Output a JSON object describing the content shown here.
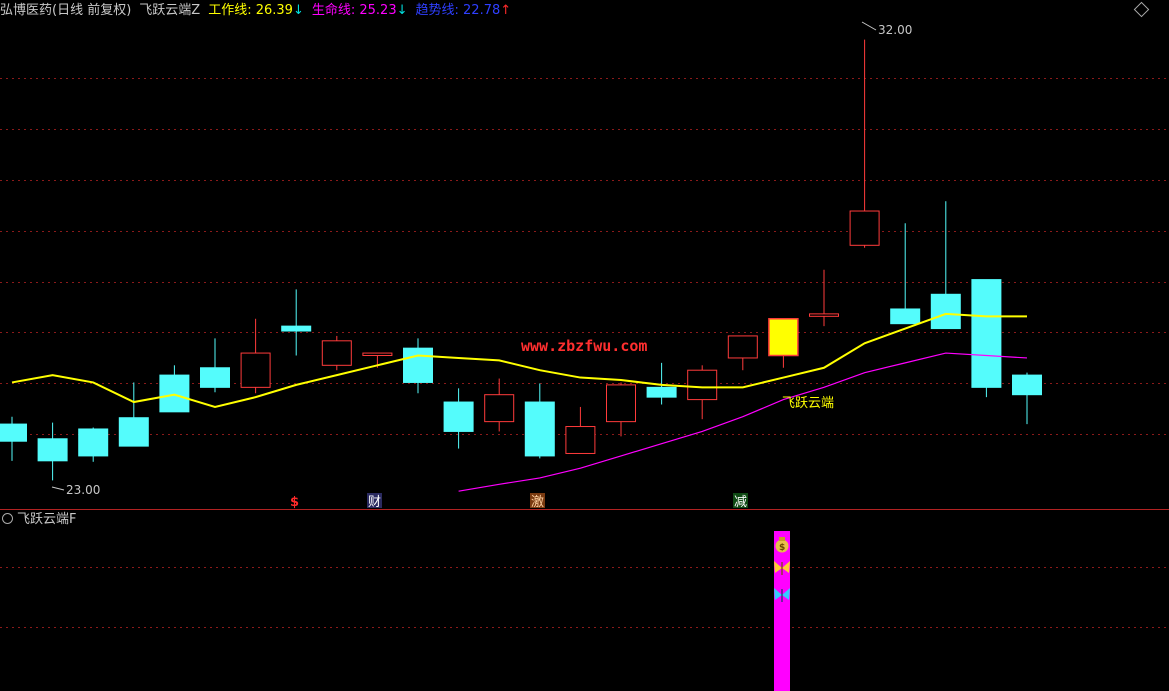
{
  "header": {
    "stock": "弘博医药(日线 前复权)",
    "indicator": "飞跃云端Z",
    "work_line_label": "工作线:",
    "work_line_value": "26.39",
    "work_line_arrow": "↓",
    "life_line_label": "生命线:",
    "life_line_value": "25.23",
    "life_line_arrow": "↓",
    "trend_line_label": "趋势线:",
    "trend_line_value": "22.78",
    "trend_line_arrow": "↑"
  },
  "sub_panel": {
    "title": "飞跃云端F"
  },
  "colors": {
    "background": "#000000",
    "up": "#ff3b3b",
    "down": "#54fcfc",
    "limit_up": "#ffff00",
    "work_line": "#ffff00",
    "life_line": "#ff00ff",
    "trend_line": "#2f3fff",
    "grid": "#8b1a1a",
    "signal_bar": "#ff00ff"
  },
  "annotations": {
    "max_price": "32.00",
    "min_price": "23.00",
    "watermark": "www.zbzfwu.com",
    "line_label": "飞跃云端",
    "signal_dollar": "$",
    "signal_cai": "财",
    "signal_ji": "激",
    "signal_jian": "减"
  },
  "icons": [
    "collapse-icon",
    "circle-icon",
    "money-bag-icon",
    "butterfly-gold-icon",
    "butterfly-cyan-icon"
  ],
  "chart_data": {
    "type": "candlestick",
    "y_range": [
      22.6,
      32.4
    ],
    "candles": [
      {
        "open": 24.15,
        "close": 23.8,
        "high": 24.3,
        "low": 23.4
      },
      {
        "open": 23.85,
        "close": 23.4,
        "high": 24.18,
        "low": 23.0
      },
      {
        "open": 24.05,
        "close": 23.5,
        "high": 24.08,
        "low": 23.38
      },
      {
        "open": 24.28,
        "close": 23.7,
        "high": 25.0,
        "low": 23.7
      },
      {
        "open": 25.15,
        "close": 24.4,
        "high": 25.35,
        "low": 24.4
      },
      {
        "open": 25.3,
        "close": 24.9,
        "high": 25.9,
        "low": 24.8
      },
      {
        "open": 24.9,
        "close": 25.6,
        "high": 26.3,
        "low": 24.78
      },
      {
        "open": 26.15,
        "close": 26.05,
        "high": 26.9,
        "low": 25.55
      },
      {
        "open": 25.35,
        "close": 25.85,
        "high": 25.95,
        "low": 25.25
      },
      {
        "open": 25.55,
        "close": 25.6,
        "high": 25.6,
        "low": 25.3
      },
      {
        "open": 25.7,
        "close": 25.0,
        "high": 25.9,
        "low": 24.78
      },
      {
        "open": 24.6,
        "close": 24.0,
        "high": 24.88,
        "low": 23.65
      },
      {
        "open": 24.2,
        "close": 24.75,
        "high": 25.08,
        "low": 24.0
      },
      {
        "open": 24.6,
        "close": 23.5,
        "high": 24.98,
        "low": 23.45
      },
      {
        "open": 23.55,
        "close": 24.1,
        "high": 24.5,
        "low": 23.55
      },
      {
        "open": 24.2,
        "close": 24.95,
        "high": 25.0,
        "low": 23.9
      },
      {
        "open": 24.9,
        "close": 24.7,
        "high": 25.4,
        "low": 24.55
      },
      {
        "open": 24.65,
        "close": 25.25,
        "high": 25.35,
        "low": 24.25
      },
      {
        "open": 25.5,
        "close": 25.95,
        "high": 25.95,
        "low": 25.25
      },
      {
        "open": 25.55,
        "close": 26.3,
        "high": 26.3,
        "low": 25.3,
        "limit_up": true
      },
      {
        "open": 26.35,
        "close": 26.4,
        "high": 27.3,
        "low": 26.15
      },
      {
        "open": 27.8,
        "close": 28.5,
        "high": 32.0,
        "low": 27.75
      },
      {
        "open": 26.5,
        "close": 26.2,
        "high": 28.25,
        "low": 26.2
      },
      {
        "open": 26.8,
        "close": 26.1,
        "high": 28.7,
        "low": 26.1
      },
      {
        "open": 27.1,
        "close": 24.9,
        "high": 27.1,
        "low": 24.7
      },
      {
        "open": 25.15,
        "close": 24.75,
        "high": 25.2,
        "low": 24.15
      }
    ],
    "work_line": [
      {
        "i": 0,
        "v": 25.0
      },
      {
        "i": 1,
        "v": 25.15
      },
      {
        "i": 2,
        "v": 25.0
      },
      {
        "i": 3,
        "v": 24.6
      },
      {
        "i": 4,
        "v": 24.75
      },
      {
        "i": 5,
        "v": 24.5
      },
      {
        "i": 6,
        "v": 24.7
      },
      {
        "i": 7,
        "v": 24.95
      },
      {
        "i": 8,
        "v": 25.15
      },
      {
        "i": 9,
        "v": 25.35
      },
      {
        "i": 10,
        "v": 25.55
      },
      {
        "i": 11,
        "v": 25.5
      },
      {
        "i": 12,
        "v": 25.45
      },
      {
        "i": 13,
        "v": 25.25
      },
      {
        "i": 14,
        "v": 25.1
      },
      {
        "i": 15,
        "v": 25.05
      },
      {
        "i": 16,
        "v": 24.95
      },
      {
        "i": 17,
        "v": 24.9
      },
      {
        "i": 18,
        "v": 24.9
      },
      {
        "i": 19,
        "v": 25.1
      },
      {
        "i": 20,
        "v": 25.3
      },
      {
        "i": 21,
        "v": 25.8
      },
      {
        "i": 22,
        "v": 26.1
      },
      {
        "i": 23,
        "v": 26.4
      },
      {
        "i": 24,
        "v": 26.35
      },
      {
        "i": 25,
        "v": 26.35
      }
    ],
    "life_line": [
      {
        "i": 11,
        "v": 22.78
      },
      {
        "i": 12,
        "v": 22.92
      },
      {
        "i": 13,
        "v": 23.05
      },
      {
        "i": 14,
        "v": 23.25
      },
      {
        "i": 15,
        "v": 23.5
      },
      {
        "i": 16,
        "v": 23.75
      },
      {
        "i": 17,
        "v": 24.0
      },
      {
        "i": 18,
        "v": 24.3
      },
      {
        "i": 19,
        "v": 24.65
      },
      {
        "i": 20,
        "v": 24.9
      },
      {
        "i": 21,
        "v": 25.2
      },
      {
        "i": 22,
        "v": 25.4
      },
      {
        "i": 23,
        "v": 25.6
      },
      {
        "i": 24,
        "v": 25.55
      },
      {
        "i": 25,
        "v": 25.5
      }
    ]
  }
}
